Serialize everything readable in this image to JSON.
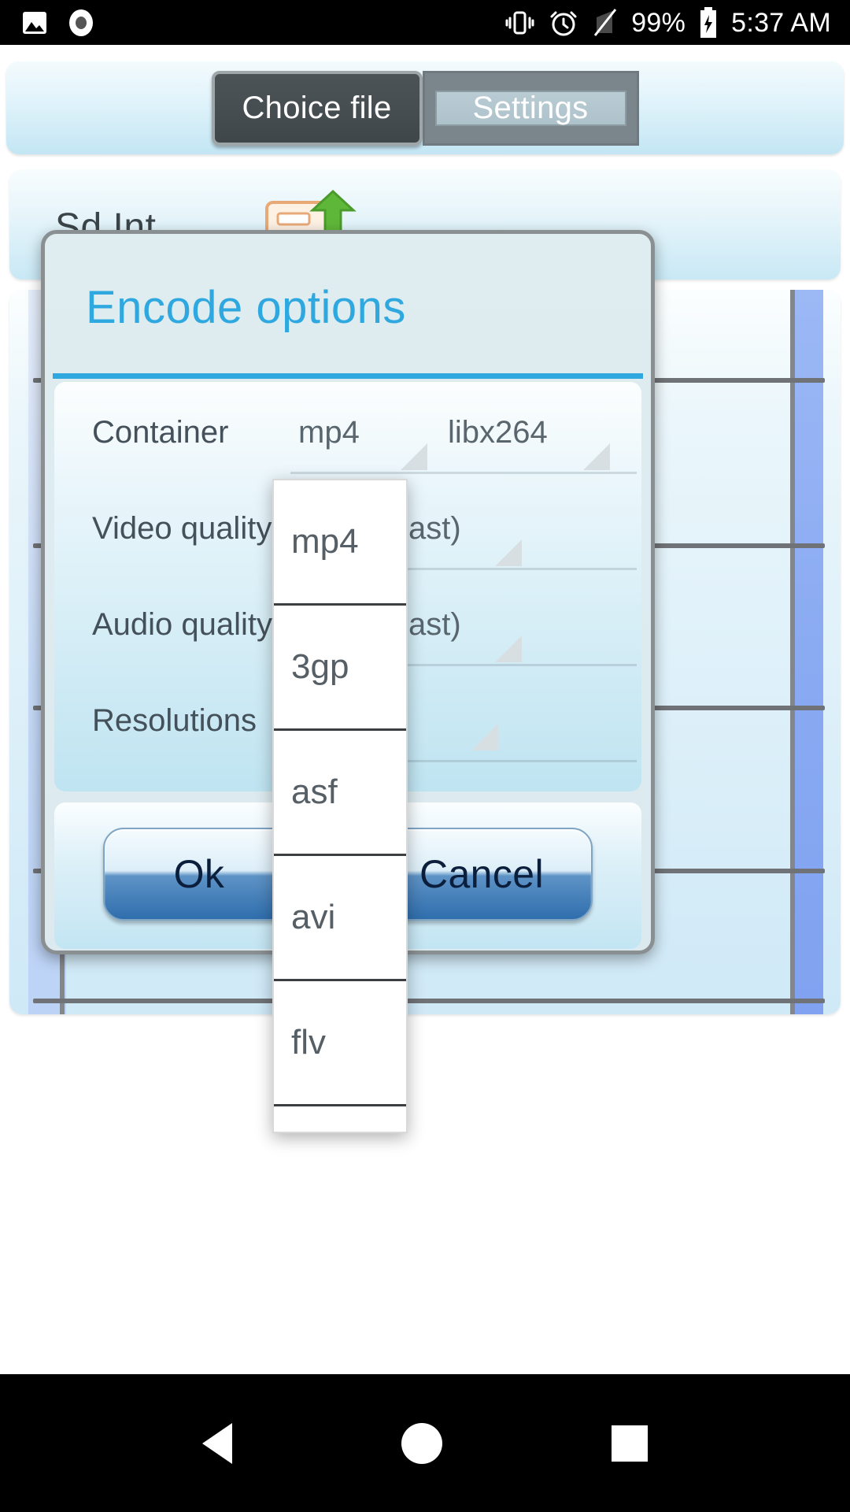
{
  "status_bar": {
    "icons_left": [
      "image-icon",
      "record-icon"
    ],
    "icons_right": [
      "vibrate-icon",
      "alarm-icon",
      "signal-off-icon"
    ],
    "battery_percent": "99%",
    "battery_icon": "battery-charging-icon",
    "time": "5:37 AM"
  },
  "tabs": {
    "items": [
      {
        "label": "Choice file",
        "selected": true
      },
      {
        "label": "Settings",
        "selected": false
      }
    ]
  },
  "file_panel": {
    "label": "Sd Int",
    "icon": "folder-upload-icon"
  },
  "dialog": {
    "title": "Encode options",
    "rows": [
      {
        "label": "Container",
        "value_a": "mp4",
        "value_b": "libx264"
      },
      {
        "label": "Video quality:",
        "value_a": "",
        "value_b": "ast)"
      },
      {
        "label": "Audio quality",
        "value_a": "",
        "value_b": "ast)"
      },
      {
        "label": "Resolutions",
        "value_a": "",
        "value_b": ""
      }
    ],
    "buttons": {
      "ok": "Ok",
      "cancel": "Cancel"
    }
  },
  "dropdown": {
    "open": true,
    "selected": "mp4",
    "options": [
      "mp4",
      "3gp",
      "asf",
      "avi",
      "flv"
    ]
  },
  "nav_bar": {
    "back": "back-icon",
    "home": "home-icon",
    "recents": "recents-icon"
  },
  "colors": {
    "accent": "#2fa8e0",
    "panel_top": "#f3fbfd",
    "panel_bottom": "#c3e6f4",
    "tab_active_bg": "#474e52",
    "tab_inactive_bg": "#7b868c",
    "text_primary": "#44505a",
    "text_secondary": "#5a666e",
    "status_bar_bg": "#000000"
  }
}
